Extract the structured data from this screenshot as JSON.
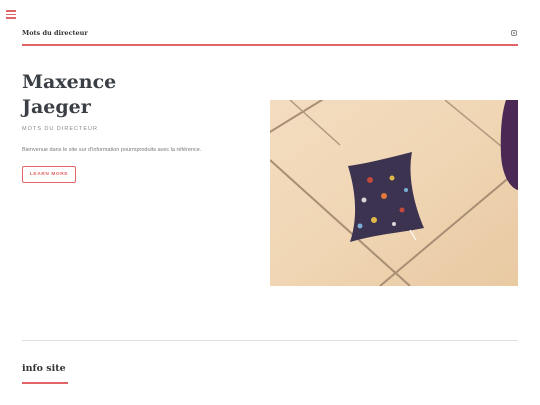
{
  "header": {
    "site_title": "Mots du directeur",
    "menu_icon": "hamburger-menu-icon",
    "social_icon": "instagram-icon",
    "accent_color": "#e06567"
  },
  "hero": {
    "name_line1": "Maxence",
    "name_line2": "Jaeger",
    "subtitle": "MOTS DU DIRECTEUR",
    "description": "Bienvenue dans le site sur d'information pourmproduits avec la référence.",
    "cta_label": "LEARN MORE"
  },
  "section": {
    "title": "info site"
  }
}
